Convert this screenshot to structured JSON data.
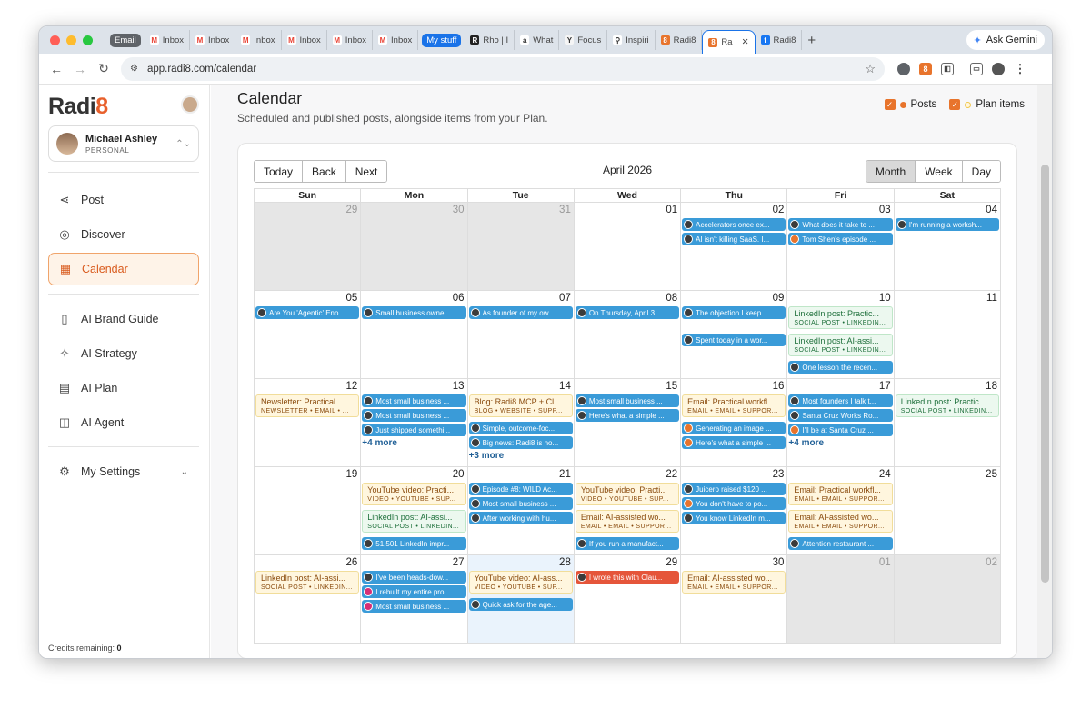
{
  "browser": {
    "tab_group_email": "Email",
    "tab_group_mystuff": "My stuff",
    "tabs_email": [
      "Inbox",
      "Inbox",
      "Inbox",
      "Inbox",
      "Inbox",
      "Inbox"
    ],
    "tabs_other": [
      "Rho | I",
      "What",
      "Focus",
      "Inspiri",
      "Radi8",
      "Ra",
      "Radi8"
    ],
    "ask": "Ask Gemini",
    "url": "app.radi8.com/calendar",
    "colors": {
      "email_group": "#5f6368",
      "mystuff_group": "#1a73e8",
      "gmail": "#ea4335"
    }
  },
  "sidebar": {
    "logo": "Radi",
    "logo_accent": "8",
    "account_name": "Michael Ashley",
    "account_type": "PERSONAL",
    "items": [
      {
        "label": "Post",
        "icon": "share-icon"
      },
      {
        "label": "Discover",
        "icon": "compass-icon"
      },
      {
        "label": "Calendar",
        "icon": "calendar-icon"
      },
      {
        "label": "AI Brand Guide",
        "icon": "book-icon"
      },
      {
        "label": "AI Strategy",
        "icon": "sparkles-icon"
      },
      {
        "label": "AI Plan",
        "icon": "calendar-plan-icon"
      },
      {
        "label": "AI Agent",
        "icon": "robot-icon"
      },
      {
        "label": "My Settings",
        "icon": "gear-icon"
      }
    ],
    "credits_label": "Credits remaining:",
    "credits_value": "0"
  },
  "page": {
    "title": "Calendar",
    "subtitle": "Scheduled and published posts, alongside items from your Plan.",
    "legend_posts": "Posts",
    "legend_plan": "Plan items",
    "colors": {
      "accent": "#e8742c",
      "post_event": "#3a9bd8",
      "plan_yellow": "#fff6de",
      "plan_green": "#ecf8ef"
    }
  },
  "calendar": {
    "btn_today": "Today",
    "btn_back": "Back",
    "btn_next": "Next",
    "month_label": "April 2026",
    "view_month": "Month",
    "view_week": "Week",
    "view_day": "Day",
    "days": [
      "Sun",
      "Mon",
      "Tue",
      "Wed",
      "Thu",
      "Fri",
      "Sat"
    ],
    "weeks": [
      [
        {
          "d": "29",
          "other": true
        },
        {
          "d": "30",
          "other": true
        },
        {
          "d": "31",
          "other": true
        },
        {
          "d": "01"
        },
        {
          "d": "02",
          "items": [
            {
              "k": "post",
              "t": "Accelerators once ex..."
            },
            {
              "k": "post",
              "t": "AI isn't killing SaaS. I..."
            }
          ]
        },
        {
          "d": "03",
          "items": [
            {
              "k": "post",
              "t": "What does it take to ..."
            },
            {
              "k": "post",
              "i": "orange",
              "t": "Tom Shen's episode ..."
            }
          ]
        },
        {
          "d": "04",
          "items": [
            {
              "k": "post",
              "t": "I'm running a worksh..."
            }
          ]
        }
      ],
      [
        {
          "d": "05",
          "items": [
            {
              "k": "post",
              "t": "Are You 'Agentic' Eno..."
            }
          ]
        },
        {
          "d": "06",
          "items": [
            {
              "k": "post",
              "t": "Small business owne..."
            }
          ]
        },
        {
          "d": "07",
          "items": [
            {
              "k": "post",
              "t": "As founder of my ow..."
            }
          ]
        },
        {
          "d": "08",
          "items": [
            {
              "k": "post",
              "t": "On Thursday, April 3..."
            }
          ]
        },
        {
          "d": "09",
          "items": [
            {
              "k": "post",
              "t": "The objection I keep ..."
            },
            {
              "k": "post",
              "t": "Spent today in a wor..."
            }
          ]
        },
        {
          "d": "10",
          "items": [
            {
              "k": "green",
              "t": "LinkedIn post: Practic...",
              "m": "SOCIAL POST • LINKEDIN..."
            },
            {
              "k": "green",
              "t": "LinkedIn post: AI-assi...",
              "m": "SOCIAL POST • LINKEDIN..."
            },
            {
              "k": "post",
              "t": "One lesson the recen..."
            }
          ]
        },
        {
          "d": "11"
        }
      ],
      [
        {
          "d": "12",
          "items": [
            {
              "k": "yellow",
              "t": "Newsletter: Practical ...",
              "m": "NEWSLETTER • EMAIL • ..."
            }
          ]
        },
        {
          "d": "13",
          "items": [
            {
              "k": "post",
              "t": "Most small business ..."
            },
            {
              "k": "post",
              "t": "Most small business ..."
            },
            {
              "k": "post",
              "t": "Just shipped somethi..."
            }
          ],
          "more": "+4 more"
        },
        {
          "d": "14",
          "items": [
            {
              "k": "yellow",
              "t": "Blog: Radi8 MCP + Cl...",
              "m": "BLOG • WEBSITE • SUPP..."
            },
            {
              "k": "post",
              "t": "Simple, outcome-foc..."
            },
            {
              "k": "post",
              "t": "Big news: Radi8 is no..."
            }
          ],
          "more": "+3 more"
        },
        {
          "d": "15",
          "items": [
            {
              "k": "post",
              "t": "Most small business ..."
            },
            {
              "k": "post",
              "t": "Here's what a simple ..."
            }
          ]
        },
        {
          "d": "16",
          "items": [
            {
              "k": "yellow",
              "t": "Email: Practical workfl...",
              "m": "EMAIL • EMAIL • SUPPOR..."
            },
            {
              "k": "post",
              "i": "orange",
              "t": "Generating an image ..."
            },
            {
              "k": "post",
              "i": "orange",
              "t": "Here's what a simple ..."
            }
          ]
        },
        {
          "d": "17",
          "items": [
            {
              "k": "post",
              "t": "Most founders I talk t..."
            },
            {
              "k": "post",
              "t": "Santa Cruz Works Ro..."
            },
            {
              "k": "post",
              "i": "orange",
              "t": "I'll be at Santa Cruz ..."
            }
          ],
          "more": "+4 more"
        },
        {
          "d": "18",
          "items": [
            {
              "k": "green",
              "t": "LinkedIn post: Practic...",
              "m": "SOCIAL POST • LINKEDIN..."
            }
          ]
        }
      ],
      [
        {
          "d": "19"
        },
        {
          "d": "20",
          "items": [
            {
              "k": "yellow",
              "t": "YouTube video: Practi...",
              "m": "VIDEO • YOUTUBE • SUP..."
            },
            {
              "k": "green",
              "t": "LinkedIn post: AI-assi...",
              "m": "SOCIAL POST • LINKEDIN..."
            },
            {
              "k": "post",
              "t": "51,501 LinkedIn impr..."
            }
          ]
        },
        {
          "d": "21",
          "items": [
            {
              "k": "post",
              "t": "Episode #8: WILD Ac..."
            },
            {
              "k": "post",
              "t": "Most small business ..."
            },
            {
              "k": "post",
              "t": "After working with hu..."
            }
          ]
        },
        {
          "d": "22",
          "items": [
            {
              "k": "yellow",
              "t": "YouTube video: Practi...",
              "m": "VIDEO • YOUTUBE • SUP..."
            },
            {
              "k": "yellow",
              "t": "Email: AI-assisted wo...",
              "m": "EMAIL • EMAIL • SUPPOR..."
            },
            {
              "k": "post",
              "t": "If you run a manufact..."
            }
          ]
        },
        {
          "d": "23",
          "items": [
            {
              "k": "post",
              "t": "Juicero raised $120 ..."
            },
            {
              "k": "post",
              "i": "orange",
              "t": "You don't have to po..."
            },
            {
              "k": "post",
              "t": "You know LinkedIn m..."
            }
          ]
        },
        {
          "d": "24",
          "items": [
            {
              "k": "yellow",
              "t": "Email: Practical workfl...",
              "m": "EMAIL • EMAIL • SUPPOR..."
            },
            {
              "k": "yellow",
              "t": "Email: AI-assisted wo...",
              "m": "EMAIL • EMAIL • SUPPOR..."
            },
            {
              "k": "post",
              "t": "Attention restaurant ..."
            }
          ]
        },
        {
          "d": "25"
        }
      ],
      [
        {
          "d": "26",
          "items": [
            {
              "k": "yellow",
              "t": "LinkedIn post: AI-assi...",
              "m": "SOCIAL POST • LINKEDIN..."
            }
          ]
        },
        {
          "d": "27",
          "items": [
            {
              "k": "post",
              "t": "I've been heads-dow..."
            },
            {
              "k": "post",
              "i": "pink",
              "t": "I rebuilt my entire pro..."
            },
            {
              "k": "post",
              "i": "pink",
              "t": "Most small business ..."
            }
          ]
        },
        {
          "d": "28",
          "today": true,
          "items": [
            {
              "k": "yellow",
              "t": "YouTube video: AI-ass...",
              "m": "VIDEO • YOUTUBE • SUP..."
            },
            {
              "k": "post",
              "t": "Quick ask for the age..."
            }
          ]
        },
        {
          "d": "29",
          "items": [
            {
              "k": "red",
              "t": "I wrote this with Clau..."
            }
          ]
        },
        {
          "d": "30",
          "items": [
            {
              "k": "yellow",
              "t": "Email: AI-assisted wo...",
              "m": "EMAIL • EMAIL • SUPPOR..."
            }
          ]
        },
        {
          "d": "01",
          "other": true
        },
        {
          "d": "02",
          "other": true
        }
      ]
    ]
  }
}
